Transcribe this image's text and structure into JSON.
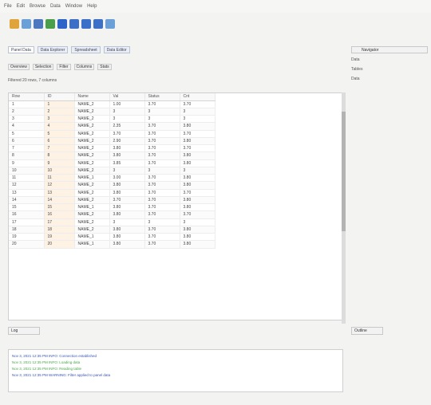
{
  "menubar": {
    "items": [
      "File",
      "Edit",
      "Browse",
      "Data",
      "Window",
      "Help"
    ]
  },
  "toolbar": {
    "buttons": [
      {
        "icon": "folder-icon",
        "color": "#e0a53a"
      },
      {
        "icon": "new-icon",
        "color": "#6aa0d8"
      },
      {
        "icon": "save-icon",
        "color": "#4d78c0"
      },
      {
        "icon": "refresh-icon",
        "color": "#4aa04a"
      },
      {
        "icon": "run-icon",
        "color": "#2d64c8"
      },
      {
        "icon": "debug-icon",
        "color": "#3b6fc8"
      },
      {
        "icon": "stop-icon",
        "color": "#3b6fc8"
      },
      {
        "icon": "step-icon",
        "color": "#3b6fc8"
      },
      {
        "icon": "filter-icon",
        "color": "#6a9fd8"
      }
    ]
  },
  "tabs": [
    "Panel Data",
    "Data Explorer",
    "Spreadsheet",
    "Data Editor"
  ],
  "subtabs": [
    "Overview",
    "Selection",
    "Filter",
    "Columns",
    "Stats"
  ],
  "statusline": "Filtered 20 rows, 7 columns",
  "table": {
    "columns": [
      "Row",
      "ID",
      "Name",
      "Val",
      "Status",
      "Cnt"
    ],
    "rows": [
      [
        "1",
        "1",
        "NAME_2",
        "1.00",
        "3.70",
        "3.70"
      ],
      [
        "2",
        "2",
        "NAME_2",
        "3",
        "3",
        "3"
      ],
      [
        "3",
        "3",
        "NAME_2",
        "3",
        "3",
        "3"
      ],
      [
        "4",
        "4",
        "NAME_2",
        "2.35",
        "3.70",
        "3.80"
      ],
      [
        "5",
        "5",
        "NAME_2",
        "3.70",
        "3.70",
        "3.70"
      ],
      [
        "6",
        "6",
        "NAME_2",
        "2.90",
        "3.70",
        "3.80"
      ],
      [
        "7",
        "7",
        "NAME_2",
        "3.80",
        "3.70",
        "3.70"
      ],
      [
        "8",
        "8",
        "NAME_2",
        "3.80",
        "3.70",
        "3.80"
      ],
      [
        "9",
        "9",
        "NAME_2",
        "3.85",
        "3.70",
        "3.80"
      ],
      [
        "10",
        "10",
        "NAME_2",
        "3",
        "3",
        "3"
      ],
      [
        "11",
        "11",
        "NAME_1",
        "3.00",
        "3.70",
        "3.80"
      ],
      [
        "12",
        "12",
        "NAME_2",
        "3.80",
        "3.70",
        "3.80"
      ],
      [
        "13",
        "13",
        "NAME_2",
        "3.80",
        "3.70",
        "3.70"
      ],
      [
        "14",
        "14",
        "NAME_2",
        "3.70",
        "3.70",
        "3.80"
      ],
      [
        "15",
        "15",
        "NAME_1",
        "3.80",
        "3.70",
        "3.80"
      ],
      [
        "16",
        "16",
        "NAME_2",
        "3.80",
        "3.70",
        "3.70"
      ],
      [
        "17",
        "17",
        "NAME_2",
        "3",
        "3",
        "3"
      ],
      [
        "18",
        "18",
        "NAME_2",
        "3.80",
        "3.70",
        "3.80"
      ],
      [
        "19",
        "19",
        "NAME_1",
        "3.80",
        "3.70",
        "3.80"
      ],
      [
        "20",
        "20",
        "NAME_1",
        "3.80",
        "3.70",
        "3.80"
      ]
    ]
  },
  "right": {
    "title": "Navigator",
    "tree": [
      {
        "label": "Data"
      },
      {
        "label": "Tables"
      },
      {
        "label": "Data"
      }
    ]
  },
  "bottom": {
    "title": "Log",
    "lines": [
      {
        "text": "Nov 3, 2021 12:35 PM INFO: Connection established",
        "color": "#3a56b8"
      },
      {
        "text": "Nov 3, 2021 12:35 PM INFO: Loading data",
        "color": "#4aa84a"
      },
      {
        "text": "Nov 3, 2021 12:35 PM INFO: Reading table",
        "color": "#4aa84a"
      },
      {
        "text": "Nov 3, 2021 12:35 PM WARNING: Filter applied to panel data",
        "color": "#3a56b8"
      }
    ]
  },
  "bottomright": {
    "title": "Outline"
  }
}
